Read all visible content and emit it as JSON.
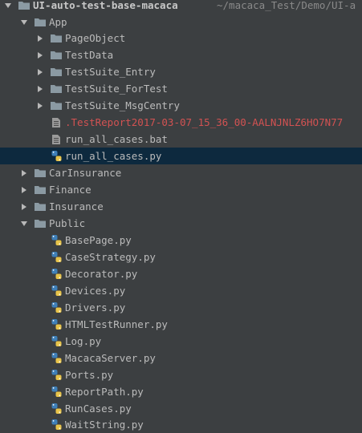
{
  "root": {
    "label": "UI-auto-test-base-macaca",
    "path": "~/macaca_Test/Demo/UI-a"
  },
  "app": {
    "label": "App",
    "folders": [
      "PageObject",
      "TestData",
      "TestSuite_Entry",
      "TestSuite_ForTest",
      "TestSuite_MsgCentry"
    ],
    "report_file": ".TestReport2017-03-07_15_36_00-AALNJNLZ6HO7N77",
    "bat_file": "run_all_cases.bat",
    "py_file": "run_all_cases.py"
  },
  "top_folders": [
    "CarInsurance",
    "Finance",
    "Insurance"
  ],
  "public": {
    "label": "Public",
    "files": [
      "BasePage.py",
      "CaseStrategy.py",
      "Decorator.py",
      "Devices.py",
      "Drivers.py",
      "HTMLTestRunner.py",
      "Log.py",
      "MacacaServer.py",
      "Ports.py",
      "ReportPath.py",
      "RunCases.py",
      "WaitString.py"
    ]
  },
  "colors": {
    "background": "#3c3f41",
    "selection": "#0d293e",
    "error_text": "#d25252",
    "folder": "#8b9aa3"
  },
  "icons": {
    "expanded": "chevron-down-icon",
    "collapsed": "chevron-right-icon",
    "folder": "folder-icon",
    "text_file": "text-file-icon",
    "python_file": "python-file-icon"
  }
}
